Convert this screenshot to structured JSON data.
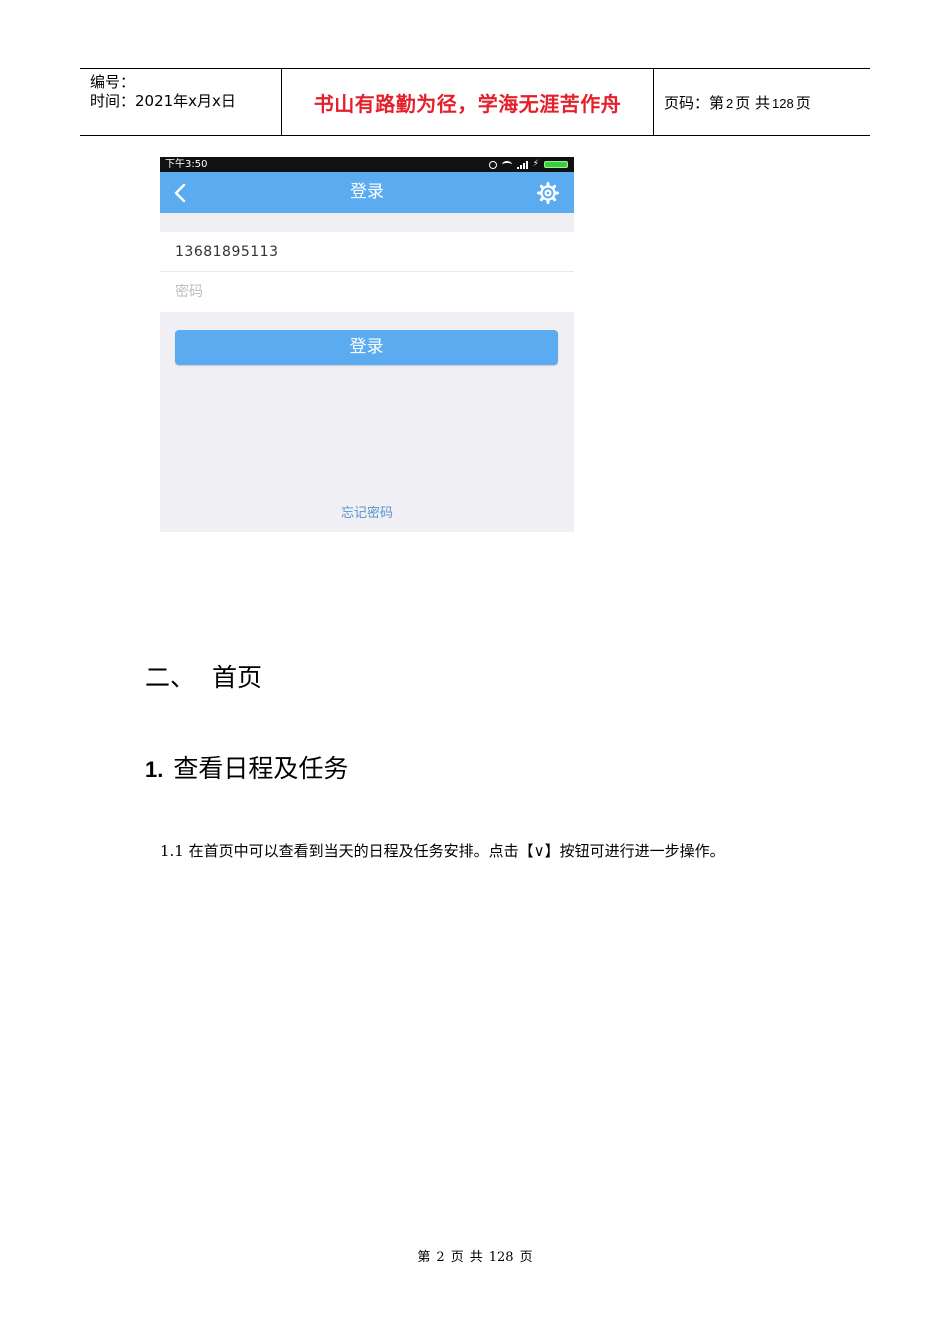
{
  "header": {
    "number_label": "编号：",
    "time_label": "时间：2021年x月x日",
    "motto": "书山有路勤为径，学海无涯苦作舟",
    "motto_color": "#e4202a",
    "page_prefix": "页码：第",
    "page_current": "2",
    "page_mid": "页  共",
    "page_total": "128",
    "page_suffix": "页"
  },
  "phone": {
    "status_time": "下午3:50",
    "nav_title": "登录",
    "username_value": "13681895113",
    "password_placeholder": "密码",
    "login_button": "登录",
    "forgot_password": "忘记密码",
    "accent_color": "#5aabf0",
    "icons": [
      "back-chevron-icon",
      "settings-gear-icon",
      "alarm-icon",
      "wifi-icon",
      "signal-icon",
      "charging-icon",
      "battery-icon"
    ]
  },
  "section": {
    "heading_num": "二、",
    "heading_text": "首页",
    "sub_num": "1.",
    "sub_text": "查看日程及任务",
    "paragraph": "1.1 在首页中可以查看到当天的日程及任务安排。点击【∨】按钮可进行进一步操作。"
  },
  "footer": {
    "prefix": "第",
    "current": "2",
    "mid1": "页",
    "mid2": "共",
    "total": "128",
    "suffix": "页"
  }
}
